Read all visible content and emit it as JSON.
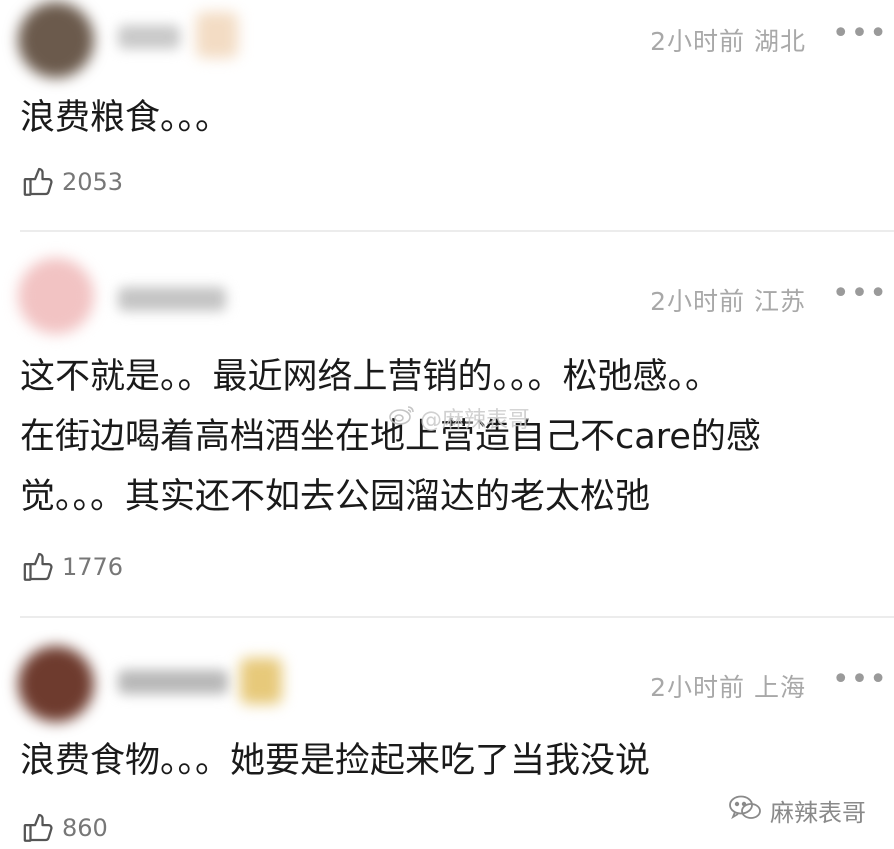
{
  "comments": [
    {
      "meta": "2小时前 湖北",
      "more_label": "•••",
      "lines": [
        "浪费粮食。。。"
      ],
      "likes": "2053",
      "avatar_color": "#6b5a4c",
      "name_color": "#c9c9c9",
      "badge_color": "#f3dcc4"
    },
    {
      "meta": "2小时前 江苏",
      "more_label": "•••",
      "lines": [
        "这不就是。。最近网络上营销的。。。松弛感。。",
        "在街边喝着高档酒坐在地上营造自己不care的感",
        "觉。。。其实还不如去公园溜达的老太松弛"
      ],
      "likes": "1776",
      "avatar_color": "#f2c3c3",
      "name_color": "#c4c4c4"
    },
    {
      "meta": "2小时前 上海",
      "more_label": "•••",
      "lines": [
        "浪费食物。。。她要是捡起来吃了当我没说"
      ],
      "likes": "860",
      "avatar_color": "#6e3b2e",
      "name_color": "#b8b8b8",
      "badge_color": "#e7c97a"
    }
  ],
  "watermarks": {
    "weibo": "@麻辣表哥",
    "wechat": "麻辣表哥"
  },
  "icons": {
    "like": "thumbs-up-icon",
    "weibo": "weibo-icon",
    "wechat": "wechat-icon"
  }
}
